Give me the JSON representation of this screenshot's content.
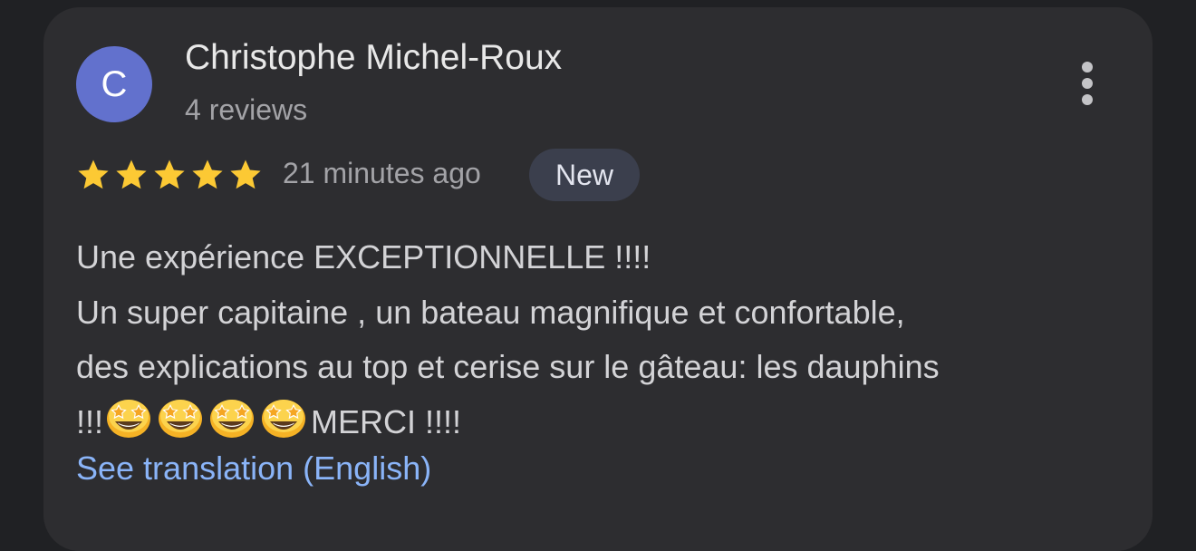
{
  "review": {
    "author": {
      "initial": "C",
      "name": "Christophe Michel-Roux",
      "reviews_count": "4 reviews",
      "avatar_color": "#6271cd"
    },
    "more_icon": "more-vert-icon",
    "rating": {
      "value": 5,
      "max": 5,
      "star_color": "#fcc934"
    },
    "time": "21 minutes ago",
    "badge": "New",
    "text": {
      "line1": "Une expérience EXCEPTIONNELLE !!!!",
      "line2": "Un super capitaine , un bateau magnifique et confortable,",
      "line3": "des explications au top et cerise sur le gâteau: les dauphins",
      "line4_prefix": "!!!",
      "line4_suffix": "MERCI !!!!"
    },
    "emojis": [
      "star-struck-emoji",
      "star-struck-emoji",
      "star-struck-emoji",
      "star-struck-emoji"
    ],
    "translation_link": "See translation (English)"
  }
}
